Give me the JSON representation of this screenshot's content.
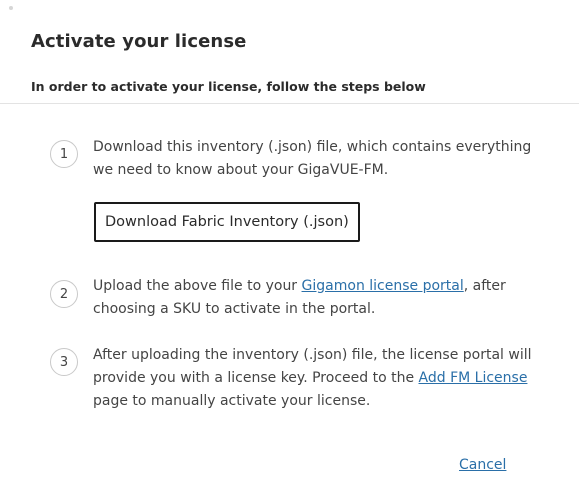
{
  "dialog": {
    "title": "Activate your license",
    "subtitle": "In order to activate your license, follow the steps below"
  },
  "steps": [
    {
      "number": "1",
      "text": "Download this inventory (.json) file, which contains everything we need to know about your GigaVUE-FM.",
      "button_label": "Download Fabric Inventory (.json)"
    },
    {
      "number": "2",
      "text_before": "Upload the above file to your ",
      "link_label": "Gigamon license portal",
      "text_after": ", after choosing a SKU to activate in the portal."
    },
    {
      "number": "3",
      "text_before": "After uploading the inventory (.json) file, the license portal will provide you with a license key. Proceed to the ",
      "link_label": "Add FM License",
      "text_after": " page to manually activate your license."
    }
  ],
  "footer": {
    "cancel_label": "Cancel"
  },
  "colors": {
    "link": "#2a6fa8",
    "text": "#444444",
    "divider": "#e3e3e3"
  }
}
